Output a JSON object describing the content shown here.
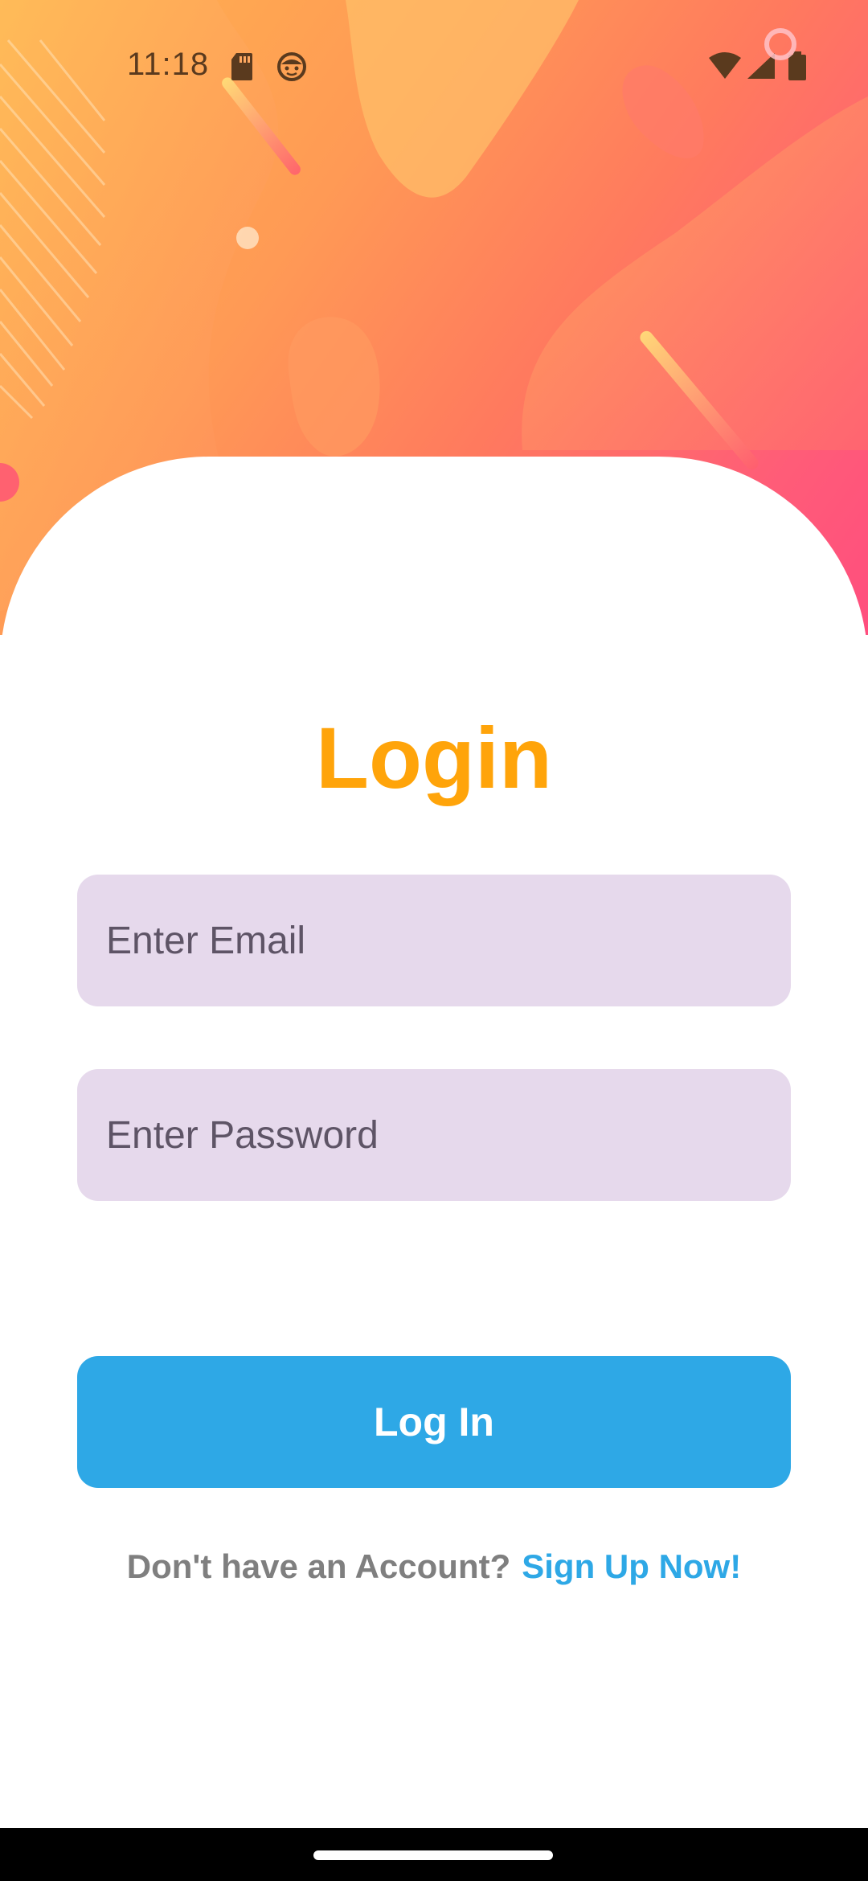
{
  "status_bar": {
    "time": "11:18",
    "icons": [
      "sd-card-icon",
      "face-notification-icon",
      "wifi-icon",
      "signal-icon",
      "battery-icon",
      "screen-record-icon"
    ]
  },
  "login": {
    "title": "Login",
    "email_placeholder": "Enter Email",
    "password_placeholder": "Enter Password",
    "login_button": "Log In",
    "signup_prompt": "Don't have an Account?",
    "signup_link": "Sign Up Now!"
  },
  "colors": {
    "title": "#ffa40a",
    "field_background": "#e6d9ec",
    "primary_button": "#2ea8e6",
    "link": "#2ea8e6",
    "hero_gradient": [
      "#ffb44e",
      "#ff7a5e",
      "#ff4e7e"
    ]
  }
}
